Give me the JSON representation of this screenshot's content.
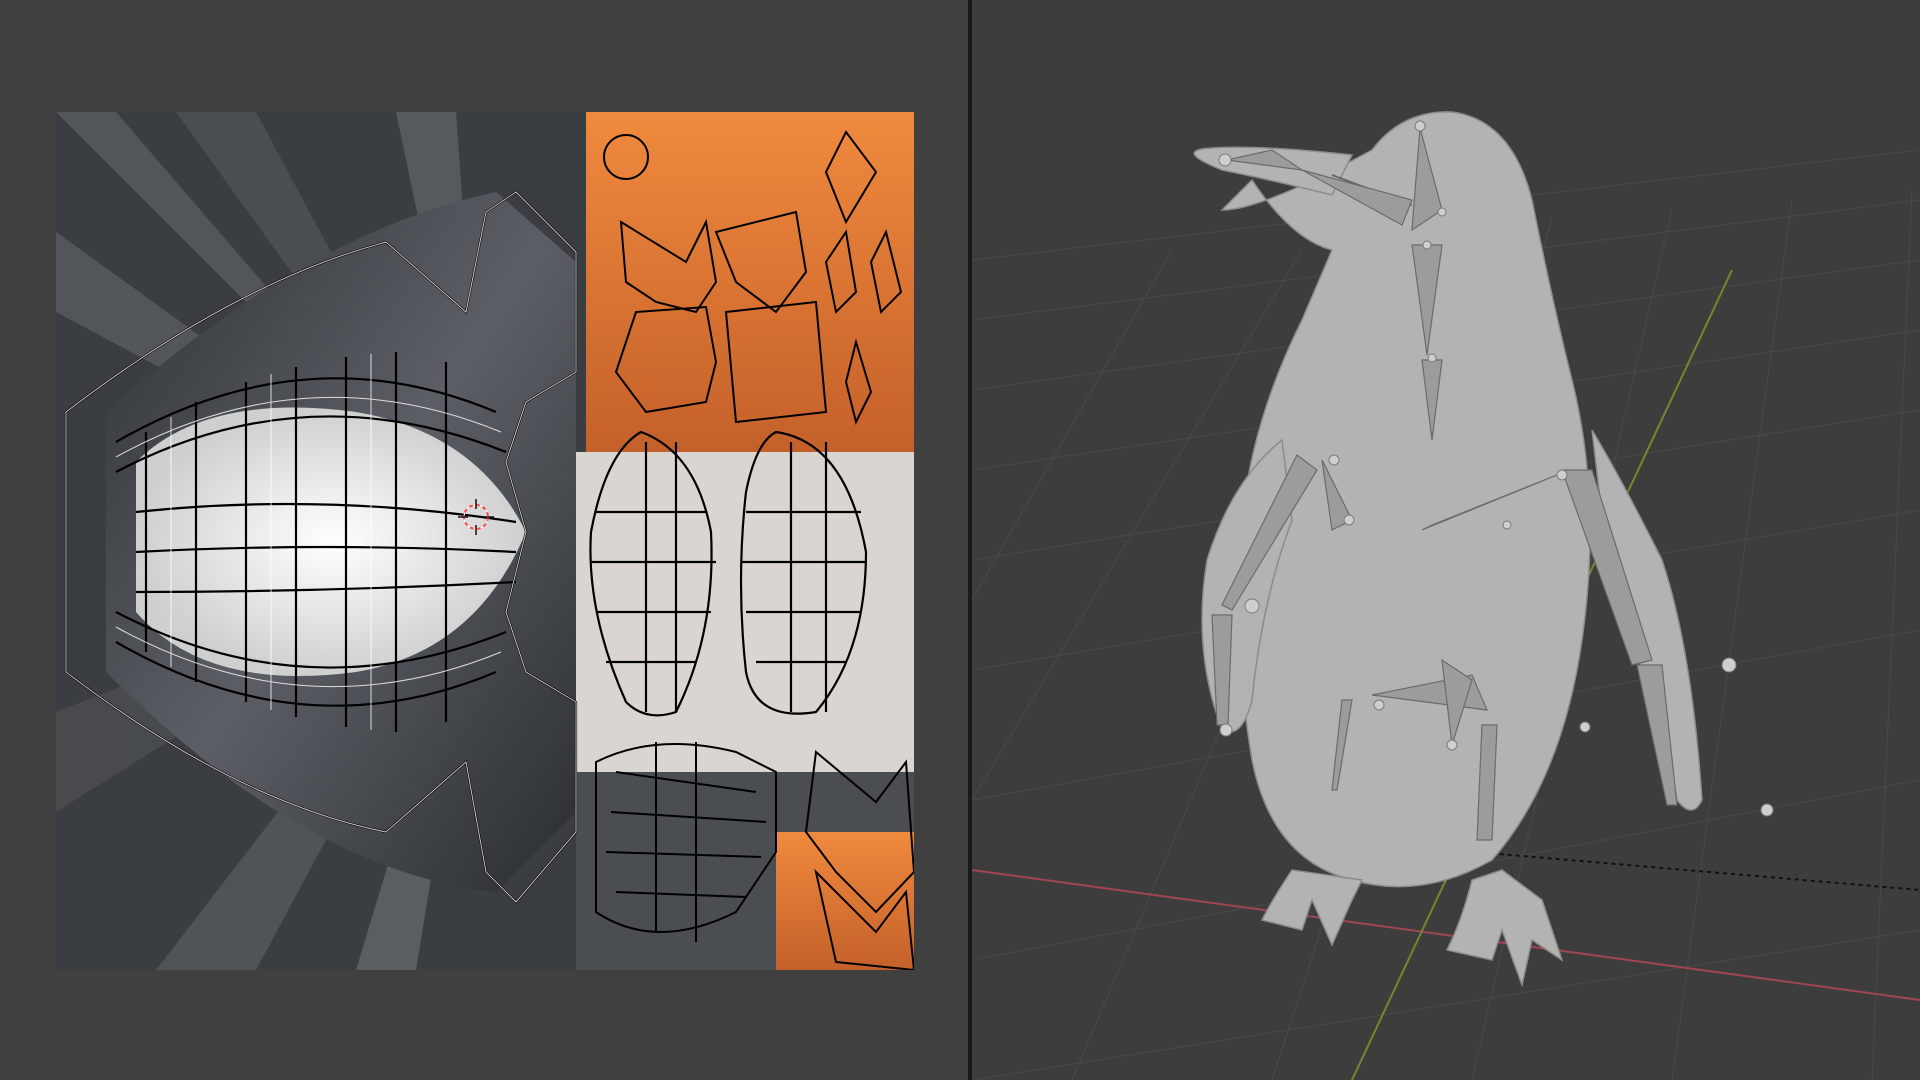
{
  "layout": {
    "left_area": "uv-editor",
    "right_area": "3d-viewport"
  },
  "colors": {
    "editor_background": "#404040",
    "viewport_background": "#3d3d3d",
    "grid": "#4a4a4a",
    "x_axis": "#a04650",
    "y_axis": "#6f8b2d",
    "mesh": "#b3b3b3",
    "uv_wire": "#000000",
    "texture_orange": "#e07a3a",
    "texture_dark": "#3c4045",
    "texture_white": "#e8e8e8"
  },
  "icons": [
    "2d-cursor-icon"
  ]
}
